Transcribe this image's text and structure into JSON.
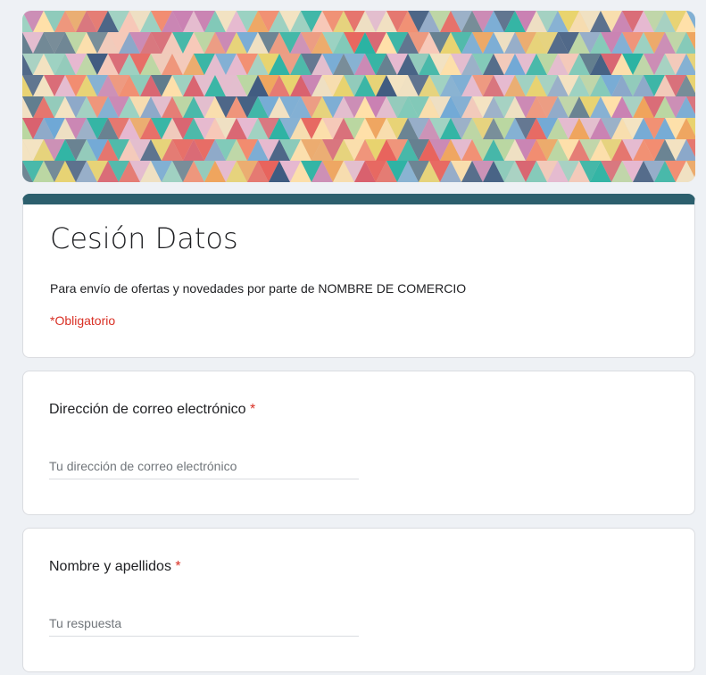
{
  "header": {
    "title": "Cesión Datos",
    "description": "Para envío de ofertas y novedades por parte de NOMBRE DE COMERCIO",
    "required_note": "*Obligatorio"
  },
  "questions": [
    {
      "label": "Dirección de correo electrónico",
      "required_mark": "*",
      "placeholder": "Tu dirección de correo electrónico",
      "value": ""
    },
    {
      "label": "Nombre y apellidos",
      "required_mark": "*",
      "placeholder": "Tu respuesta",
      "value": ""
    }
  ],
  "colors": {
    "page_background": "#eef1f5",
    "accent_bar": "#2c5f6d",
    "required": "#d93025",
    "text": "#202124",
    "placeholder": "#70757a",
    "card_border": "#dadce0"
  }
}
